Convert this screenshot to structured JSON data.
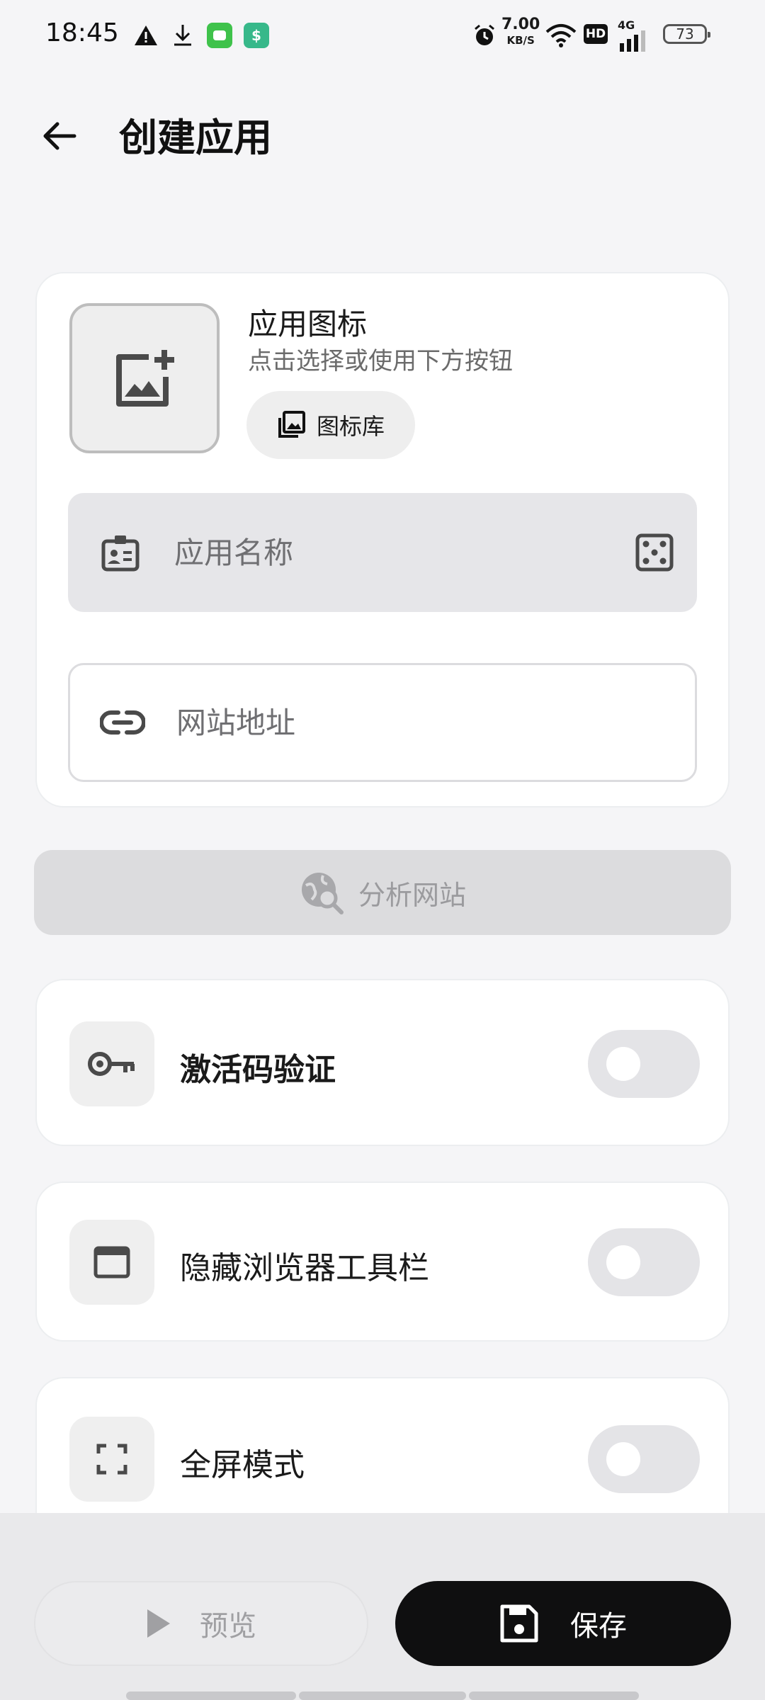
{
  "status_bar": {
    "time": "18:45",
    "net_speed": "7.00",
    "net_unit": "KB/S",
    "hd": "HD",
    "network_type": "4G",
    "battery": "73",
    "icons": [
      "warning-icon",
      "download-icon",
      "chat-app-icon",
      "shield-app-icon",
      "alarm-icon",
      "wifi-icon",
      "signal-icon"
    ]
  },
  "header": {
    "title": "创建应用"
  },
  "icon_section": {
    "title": "应用图标",
    "hint": "点击选择或使用下方按钮",
    "library_button": "图标库"
  },
  "fields": {
    "app_name_placeholder": "应用名称",
    "url_placeholder": "网站地址"
  },
  "analyze_button": "分析网站",
  "settings": [
    {
      "label": "激活码验证",
      "icon": "key-icon",
      "enabled": false
    },
    {
      "label": "隐藏浏览器工具栏",
      "icon": "browser-window-icon",
      "enabled": false
    },
    {
      "label": "全屏模式",
      "icon": "fullscreen-icon",
      "enabled": false
    }
  ],
  "footer": {
    "preview_label": "预览",
    "save_label": "保存"
  },
  "colors": {
    "background": "#f5f5f7",
    "save_button": "#0f0f10",
    "disabled": "#dcdcde"
  }
}
